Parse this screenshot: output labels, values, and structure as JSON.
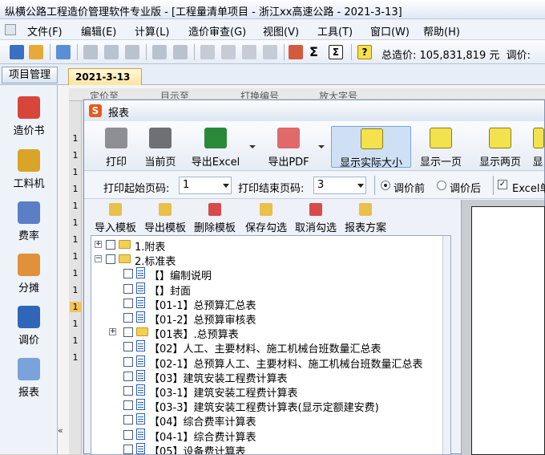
{
  "window": {
    "title": "纵横公路工程造价管理软件专业版 - [工程量清单项目 - 浙江xx高速公路 - 2021-3-13]"
  },
  "menu": [
    "文件(F)",
    "编辑(E)",
    "计算(L)",
    "造价审查(G)",
    "视图(V)",
    "工具(T)",
    "窗口(W)",
    "帮助(H)"
  ],
  "toolbar": {
    "total_label": "总造价: 105,831,819 元",
    "adjust_label": "调价:"
  },
  "tabs": {
    "project": "项目管理",
    "date_tab": "2021-3-13"
  },
  "grid": {
    "header_fragments": [
      "定价至",
      "目示至",
      "打换编号",
      "放大字号"
    ],
    "row_numbers": [
      "1",
      "1",
      "1",
      "1",
      "1",
      "1",
      "1",
      "1",
      "1",
      "1",
      "1",
      "1",
      "1",
      "1"
    ]
  },
  "nav": [
    {
      "label": "造价书",
      "icon": "cost-book-icon"
    },
    {
      "label": "工料机",
      "icon": "materials-icon"
    },
    {
      "label": "费率",
      "icon": "rate-icon"
    },
    {
      "label": "分摊",
      "icon": "allocation-icon"
    },
    {
      "label": "调价",
      "icon": "price-adjust-icon"
    },
    {
      "label": "报表",
      "icon": "report-icon"
    }
  ],
  "dialog": {
    "icon_letter": "S",
    "title": "报表",
    "buttons": [
      {
        "label": "打印",
        "icon": "printer-icon"
      },
      {
        "label": "当前页",
        "icon": "print-current-page-icon"
      },
      {
        "label": "导出Excel",
        "icon": "excel-icon"
      },
      {
        "label": "导出PDF",
        "icon": "pdf-icon"
      },
      {
        "label": "显示实际大小",
        "icon": "actual-size-icon"
      },
      {
        "label": "显示一页",
        "icon": "one-page-icon"
      },
      {
        "label": "显示两页",
        "icon": "two-pages-icon"
      },
      {
        "label": "显",
        "icon": "more-icon"
      }
    ],
    "print_start_label": "打印起始页码:",
    "print_start_value": "1",
    "print_end_label": "打印结束页码:",
    "print_end_value": "3",
    "radio_before": "调价前",
    "radio_after": "调价后",
    "excel_check": "Excel单",
    "template_buttons": [
      "导入模板",
      "导出模板",
      "删除模板",
      "保存勾选",
      "取消勾选",
      "报表方案"
    ],
    "tree": [
      {
        "text": "1.附表",
        "type": "folder",
        "level": 0,
        "expander": "+"
      },
      {
        "text": "2.标准表",
        "type": "folder",
        "level": 0,
        "expander": "-"
      },
      {
        "text": "【】编制说明",
        "type": "doc",
        "level": 1
      },
      {
        "text": "【】封面",
        "type": "doc",
        "level": 1
      },
      {
        "text": "【01-1】总预算汇总表",
        "type": "doc",
        "level": 1
      },
      {
        "text": "【01-2】总预算审核表",
        "type": "doc",
        "level": 1
      },
      {
        "text": "【01表】.总预算表",
        "type": "folder",
        "level": 1,
        "expander": "+"
      },
      {
        "text": "【02】人工、主要材料、施工机械台班数量汇总表",
        "type": "doc",
        "level": 1
      },
      {
        "text": "【02-1】总预算人工、主要材料、施工机械台班数量汇总表",
        "type": "doc",
        "level": 1
      },
      {
        "text": "【03】建筑安装工程费计算表",
        "type": "doc",
        "level": 1
      },
      {
        "text": "【03-1】建筑安装工程费计算表",
        "type": "doc",
        "level": 1
      },
      {
        "text": "【03-3】建筑安装工程费计算表(显示定额建安费)",
        "type": "doc",
        "level": 1
      },
      {
        "text": "【04】综合费率计算表",
        "type": "doc",
        "level": 1
      },
      {
        "text": "【04-1】综合费计算表",
        "type": "doc",
        "level": 1
      },
      {
        "text": "【05】设备费计算表",
        "type": "doc",
        "level": 1
      }
    ]
  }
}
